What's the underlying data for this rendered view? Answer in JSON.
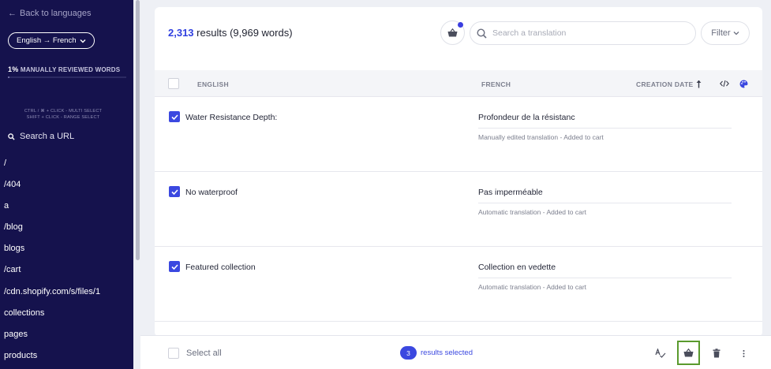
{
  "sidebar": {
    "back_label": "Back to languages",
    "language_pair": "English → French",
    "reviewed_percent": "1%",
    "reviewed_label": "MANUALLY REVIEWED WORDS",
    "reviewed_progress": 0.01,
    "hint_multi": "CTRL / ⌘ + CLICK - MULTI SELECT",
    "hint_range": "SHIFT + CLICK - RANGE SELECT",
    "search_placeholder": "Search a URL",
    "urls": [
      "/",
      "/404",
      "a",
      "/blog",
      "blogs",
      "/cart",
      "/cdn.shopify.com/s/files/1",
      "collections",
      "pages",
      "products"
    ]
  },
  "header": {
    "result_count": "2,313",
    "result_suffix": "results (9,969 words)",
    "search_placeholder": "Search a translation",
    "filter_label": "Filter"
  },
  "table": {
    "col_source": "ENGLISH",
    "col_target": "FRENCH",
    "col_date": "CREATION DATE",
    "rows": [
      {
        "source": "Water Resistance Depth:",
        "target": "Profondeur de la résistanc",
        "meta": "Manually edited translation - Added to cart",
        "checked": true
      },
      {
        "source": "No waterproof",
        "target": "Pas imperméable",
        "meta": "Automatic translation - Added to cart",
        "checked": true
      },
      {
        "source": "Featured collection",
        "target": "Collection en vedette",
        "meta": "Automatic translation - Added to cart",
        "checked": true
      }
    ]
  },
  "footer": {
    "select_all": "Select all",
    "selected_count": "3",
    "selected_label": "results selected"
  },
  "colors": {
    "sidebar_bg": "#15124d",
    "accent": "#3b48e0",
    "cart_highlight": "#5a9a2d"
  }
}
